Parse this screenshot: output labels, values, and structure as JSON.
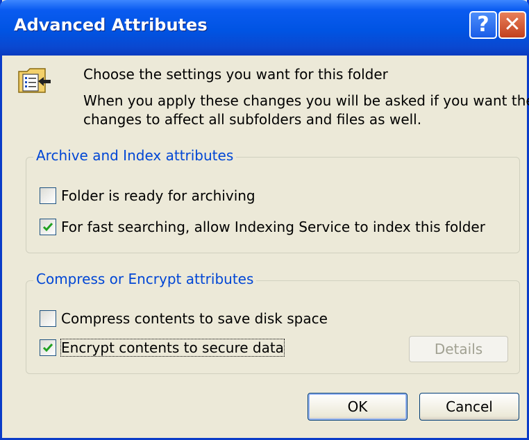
{
  "window": {
    "title": "Advanced Attributes"
  },
  "titlebar": {
    "help_glyph": "?",
    "close_glyph": "✕",
    "help_icon": "help-icon",
    "close_icon": "close-icon"
  },
  "intro": {
    "icon": "folder-attributes-icon",
    "heading": "Choose the settings you want for this folder",
    "line1": "When you apply these changes you will be asked if you want the",
    "line2": "changes to affect all subfolders and files as well."
  },
  "archive_group": {
    "legend": "Archive and Index attributes",
    "archiving": {
      "label": "Folder is ready for archiving",
      "checked": false
    },
    "indexing": {
      "label": "For fast searching, allow Indexing Service to index this folder",
      "checked": true
    }
  },
  "compress_group": {
    "legend": "Compress or Encrypt attributes",
    "compress": {
      "label": "Compress contents to save disk space",
      "checked": false
    },
    "encrypt": {
      "label": "Encrypt contents to secure data",
      "checked": true
    },
    "details_label": "Details"
  },
  "buttons": {
    "ok": "OK",
    "cancel": "Cancel"
  },
  "colors": {
    "title_bar": "#0054e3",
    "group_legend": "#0046d5",
    "face": "#ece9d8",
    "check": "#21a121"
  }
}
